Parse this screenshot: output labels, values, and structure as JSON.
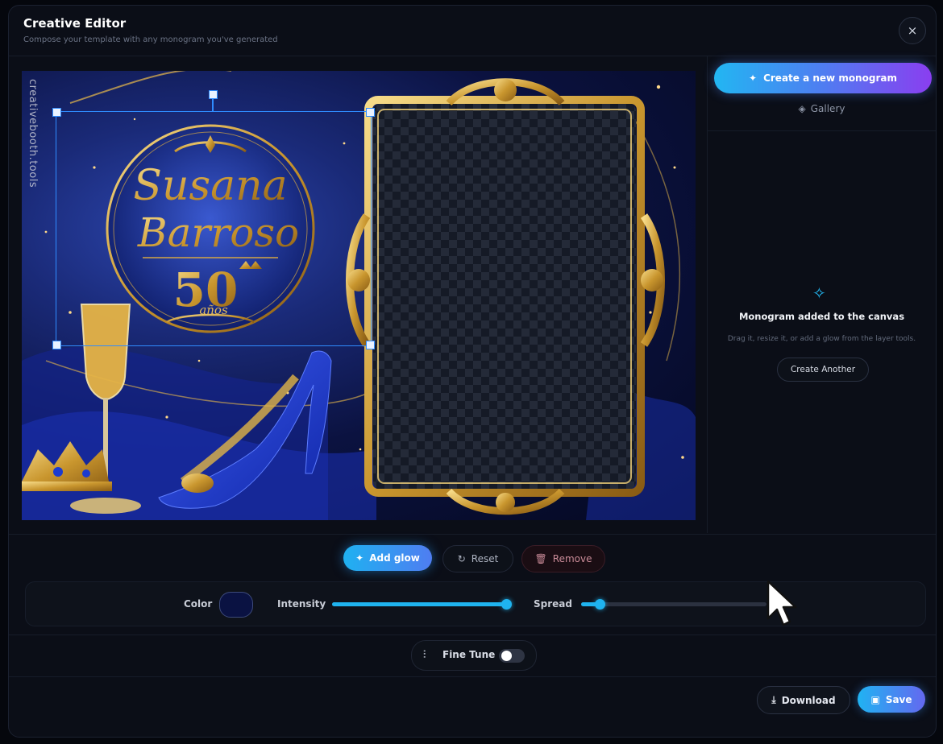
{
  "header": {
    "title": "Creative Editor",
    "subtitle": "Compose your template with any monogram you've generated",
    "close_icon": "×"
  },
  "canvas": {
    "watermark": "creativebooth.tools",
    "monogram": {
      "line1": "Susana",
      "line2": "Barroso",
      "number": "50",
      "suffix": "años"
    },
    "colors": {
      "gold": "#d7a93e",
      "navy": "#0b1240",
      "royal_blue": "#2340c8"
    }
  },
  "sidebar": {
    "create_button": "Create a new monogram",
    "gallery_link": "Gallery",
    "empty_state": {
      "title": "Monogram added to the canvas",
      "text": "Drag it, resize it, or add a glow from the layer tools.",
      "button": "Create Another"
    }
  },
  "layer_tools": {
    "add_glow": "Add glow",
    "reset": "Reset",
    "remove": "Remove"
  },
  "glow_controls": {
    "color_label": "Color",
    "color_value": "#0a1242",
    "intensity_label": "Intensity",
    "intensity": 1.0,
    "spread_label": "Spread",
    "spread": 0.1
  },
  "fine_tune": {
    "label": "Fine Tune",
    "enabled": false
  },
  "footer": {
    "download": "Download",
    "save": "Save"
  }
}
